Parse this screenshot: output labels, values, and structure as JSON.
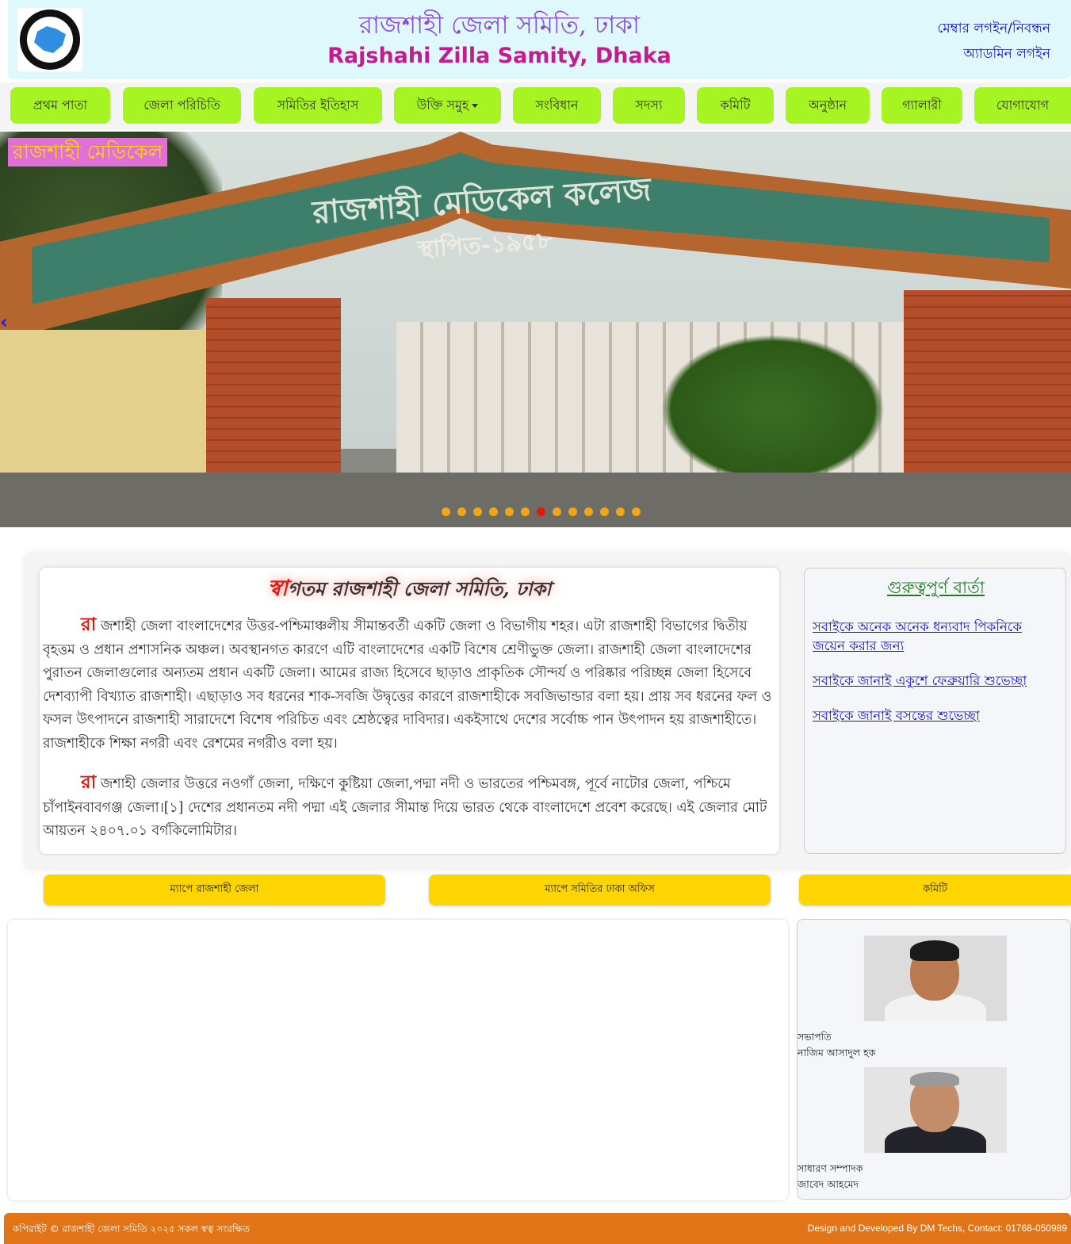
{
  "header": {
    "title_bn": "রাজশাহী জেলা সমিতি, ঢাকা",
    "title_en": "Rajshahi Zilla Samity, Dhaka",
    "member_login": "মেম্বার লগইন/নিবন্ধন",
    "admin_login": "অ্যাডমিন লগইন"
  },
  "nav": {
    "items": [
      {
        "label": "প্রথম পাতা"
      },
      {
        "label": "জেলা পরিচিতি"
      },
      {
        "label": "সমিতির ইতিহাস"
      },
      {
        "label": "উক্তি সমুহ"
      },
      {
        "label": "সংবিধান"
      },
      {
        "label": "সদস্য"
      },
      {
        "label": "কমিটি"
      },
      {
        "label": "অনুষ্ঠান"
      },
      {
        "label": "গ্যালারী"
      },
      {
        "label": "যোগাযোগ"
      }
    ]
  },
  "slider": {
    "caption": "রাজশাহী মেডিকেল",
    "sign_line1": "রাজশাহী মেডিকেল কলেজ",
    "sign_line2": "স্থাপিত-১৯৫৮",
    "prev_label": "‹",
    "slide_count": 13,
    "active_slide": 6
  },
  "welcome": {
    "title_first": "স্বা",
    "title_rest": "গতম রাজশাহী জেলা সমিতি, ঢাকা",
    "para1_cap": "রা",
    "para1_text": " জশাহী জেলা বাংলাদেশের উত্তর-পশ্চিমাঞ্চলীয় সীমান্তবর্তী একটি জেলা ও বিভাগীয় শহর। এটা রাজশাহী বিভাগের দ্বিতীয় বৃহত্তম ও প্রধান প্রশাসনিক অঞ্চল। অবস্থানগত কারণে এটি বাংলাদেশের একটি বিশেষ শ্রেণীভুক্ত জেলা। রাজশাহী জেলা বাংলাদেশের পুরাতন জেলাগুলোর অন্যতম প্রধান একটি জেলা। আমের রাজ্য হিসেবে ছাড়াও প্রাকৃতিক সৌন্দর্য ও পরিষ্কার পরিচ্ছন্ন জেলা হিসেবে দেশব্যাপী বিখ্যাত রাজশাহী। এছাড়াও সব ধরনের শাক-সবজি উদ্বৃত্তের কারণে রাজশাহীকে সবজিভান্ডার বলা হয়। প্রায় সব ধরনের ফল ও ফসল উৎপাদনে রাজশাহী সারাদেশে বিশেষ পরিচিত এবং শ্রেষ্ঠত্বের দাবিদার। একইসাথে দেশের সর্বোচ্চ পান উৎপাদন হয় রাজশাহীতে। রাজশাহীকে শিক্ষা নগরী এবং রেশমের নগরীও বলা হয়।",
    "para2_cap": "রা",
    "para2_text": " জশাহী জেলার উত্তরে নওগাঁ জেলা, দক্ষিণে কুষ্টিয়া জেলা,পদ্মা নদী ও ভারতের পশ্চিমবঙ্গ, পূর্বে নাটোর জেলা, পশ্চিমে চাঁপাইনবাবগঞ্জ জেলা।[১] দেশের প্রধানতম নদী পদ্মা এই জেলার সীমান্ত দিয়ে ভারত থেকে বাংলাদেশে প্রবেশ করেছে। এই জেলার মোট আয়তন ২৪০৭.০১ বর্গকিলোমিটার।"
  },
  "news": {
    "title": "গুরুত্বপুর্ণ বার্তা",
    "items": [
      "সবাইকে অনেক অনেক ধন্যবাদ পিকনিকে জয়েন করার জন্য",
      "সবাইকে জানাই একুশে ফেব্রুয়ারি শুভেচ্ছা",
      "সবাইকে জানাই বসন্তের শুভেচ্ছা"
    ]
  },
  "buttons": {
    "map_district": "ম্যাপে রাজশাহী জেলা",
    "map_office": "ম্যাপে সমিতির ঢাকা অফিস",
    "committee": "কমিটি"
  },
  "committee": {
    "members": [
      {
        "role": "সভাপতি",
        "name": "নাজিম আসাদুল হক"
      },
      {
        "role": "সাধারণ সম্পাদক",
        "name": "জাবেদ আহমেদ"
      }
    ]
  },
  "footer": {
    "copyright": "কপিরাইট © রাজশাহী জেলা সমিতি ২০২৫ সকল স্বত্ব সংরক্ষিত",
    "credit": "Design and Developed By DM Techs, Contact: 01768-050989"
  },
  "colors": {
    "nav_bg": "#a6f523",
    "yellow_button": "#ffd500",
    "footer_bg": "#e07416",
    "header_bg": "#dff8fb",
    "accent_red": "#e6160c"
  }
}
